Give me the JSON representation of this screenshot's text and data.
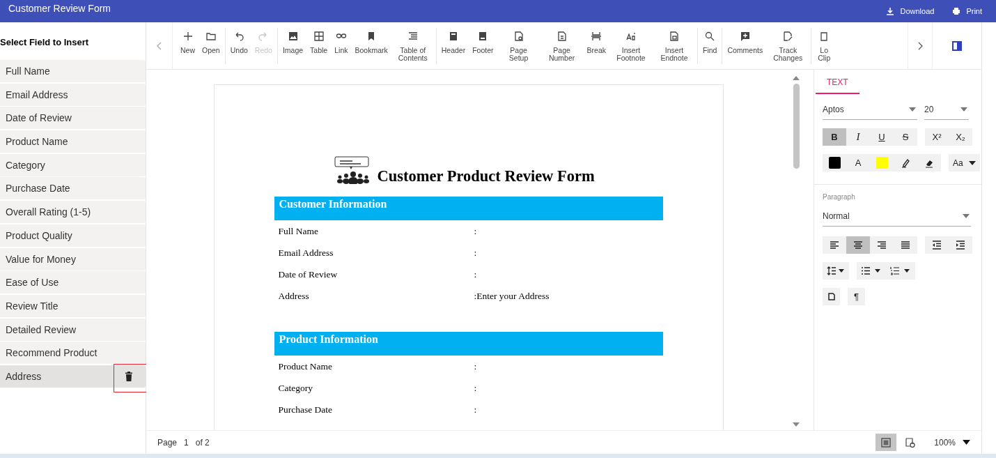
{
  "window": {
    "title": "Customer Review Form"
  },
  "header_actions": [
    {
      "label": "Download"
    },
    {
      "label": "Print"
    }
  ],
  "field_panel": {
    "title": "Select Field to Insert",
    "fields": [
      {
        "label": "Full Name",
        "selected": false
      },
      {
        "label": "Email Address",
        "selected": false
      },
      {
        "label": "Date of Review",
        "selected": false
      },
      {
        "label": "Product Name",
        "selected": false
      },
      {
        "label": "Category",
        "selected": false
      },
      {
        "label": "Purchase Date",
        "selected": false
      },
      {
        "label": "Overall Rating (1-5)",
        "selected": false
      },
      {
        "label": "Product Quality",
        "selected": false
      },
      {
        "label": "Value for Money",
        "selected": false
      },
      {
        "label": "Ease of Use",
        "selected": false
      },
      {
        "label": "Review Title",
        "selected": false
      },
      {
        "label": "Detailed Review",
        "selected": false
      },
      {
        "label": "Recommend Product",
        "selected": false
      },
      {
        "label": "Address",
        "selected": true
      }
    ]
  },
  "toolbar": {
    "groups": [
      [
        {
          "label": "New",
          "disabled": false
        },
        {
          "label": "Open",
          "disabled": false
        }
      ],
      [
        {
          "label": "Undo",
          "disabled": false
        },
        {
          "label": "Redo",
          "disabled": true
        }
      ],
      [
        {
          "label": "Image",
          "disabled": false
        },
        {
          "label": "Table",
          "disabled": false
        },
        {
          "label": "Link",
          "disabled": false
        },
        {
          "label": "Bookmark",
          "disabled": false
        },
        {
          "label": "Table of Contents",
          "disabled": false
        }
      ],
      [
        {
          "label": "Header",
          "disabled": false
        },
        {
          "label": "Footer",
          "disabled": false
        },
        {
          "label": "Page Setup",
          "disabled": false
        },
        {
          "label": "Page Number",
          "disabled": false
        },
        {
          "label": "Break",
          "disabled": false
        },
        {
          "label": "Insert Footnote",
          "disabled": false
        },
        {
          "label": "Insert Endnote",
          "disabled": false
        }
      ],
      [
        {
          "label": "Find",
          "disabled": false
        }
      ],
      [
        {
          "label": "Comments",
          "disabled": false
        },
        {
          "label": "Track Changes",
          "disabled": false
        }
      ],
      [
        {
          "label": "Lo Clip",
          "disabled": false
        }
      ]
    ]
  },
  "document": {
    "title": "Customer Product Review Form",
    "sections": [
      {
        "heading": "Customer Information",
        "rows": [
          {
            "label": "Full Name",
            "value": ":"
          },
          {
            "label": "Email Address",
            "value": ":"
          },
          {
            "label": "Date of Review",
            "value": ":"
          },
          {
            "label": "Address",
            "value": ":Enter your Address"
          }
        ]
      },
      {
        "heading": "Product Information",
        "rows": [
          {
            "label": "Product Name",
            "value": ":"
          },
          {
            "label": "Category",
            "value": ":"
          },
          {
            "label": "Purchase Date",
            "value": ":"
          }
        ]
      }
    ]
  },
  "properties": {
    "tabs": [
      {
        "label": "TEXT",
        "selected": true
      }
    ],
    "font": "Aptos",
    "size": "20",
    "styles": [
      {
        "glyph": "B",
        "selected": true
      },
      {
        "glyph": "I",
        "selected": false
      },
      {
        "glyph": "U",
        "selected": false
      },
      {
        "glyph": "S",
        "selected": false
      }
    ],
    "scripts": [
      {
        "glyph": "X²",
        "selected": false
      },
      {
        "glyph": "X₂",
        "selected": false
      }
    ],
    "font_color_glyph": "A",
    "case_glyph": "Aa",
    "paragraph_label": "Paragraph",
    "style": "Normal",
    "alignments": [
      {
        "selected": false
      },
      {
        "selected": true
      },
      {
        "selected": false
      },
      {
        "selected": false
      }
    ],
    "pilcrow": "¶"
  },
  "status_bar": {
    "page_label": "Page",
    "page": "1",
    "of": "of 2",
    "views": [
      {
        "selected": true
      },
      {
        "selected": false
      }
    ],
    "zoom": "100%"
  }
}
